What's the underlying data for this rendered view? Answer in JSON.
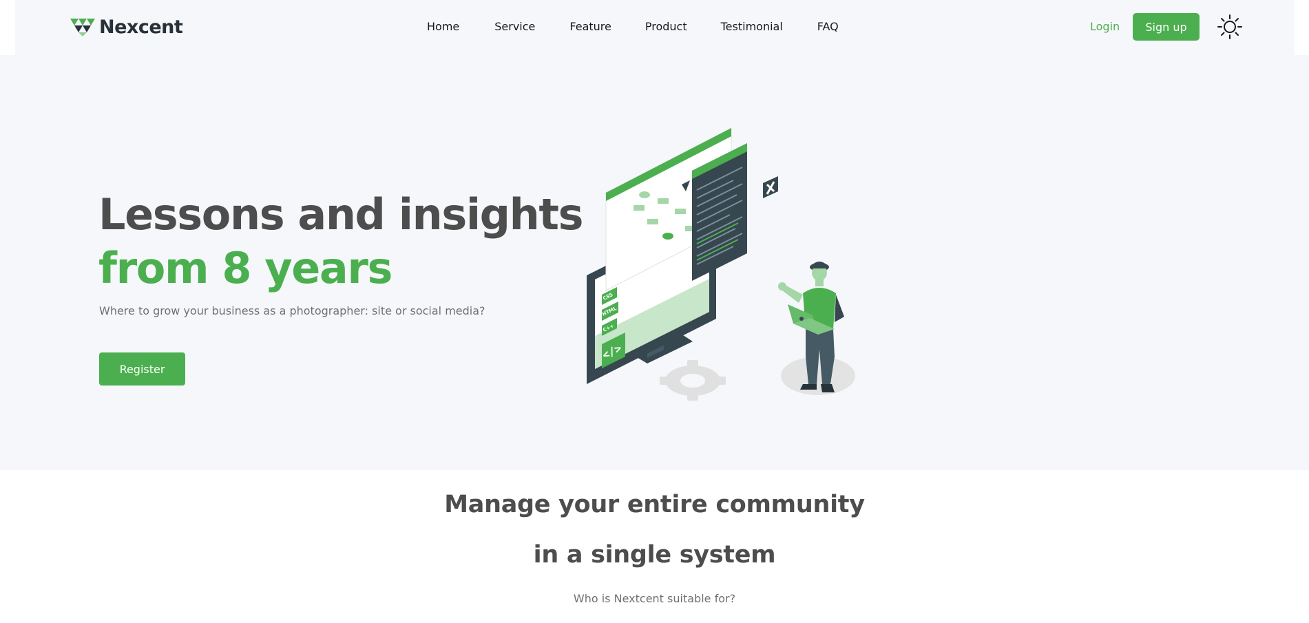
{
  "brand": {
    "name": "Nexcent",
    "accent": "#4caf4f",
    "dark": "#263238"
  },
  "nav": {
    "links": [
      "Home",
      "Service",
      "Feature",
      "Product",
      "Testimonial",
      "FAQ"
    ],
    "login_label": "Login",
    "signup_label": "Sign up",
    "theme_icon": "sun-icon"
  },
  "hero": {
    "title_line1": "Lessons and insights",
    "title_line2": "from 8 years",
    "subtitle": "Where to grow your business as a photographer: site or social media?",
    "cta_label": "Register",
    "illustration_labels": [
      "CSS",
      "HTML",
      "C++"
    ]
  },
  "section": {
    "title_line1": "Manage your entire community",
    "title_line2": "in a single system",
    "subtitle": "Who is Nextcent suitable for?"
  }
}
